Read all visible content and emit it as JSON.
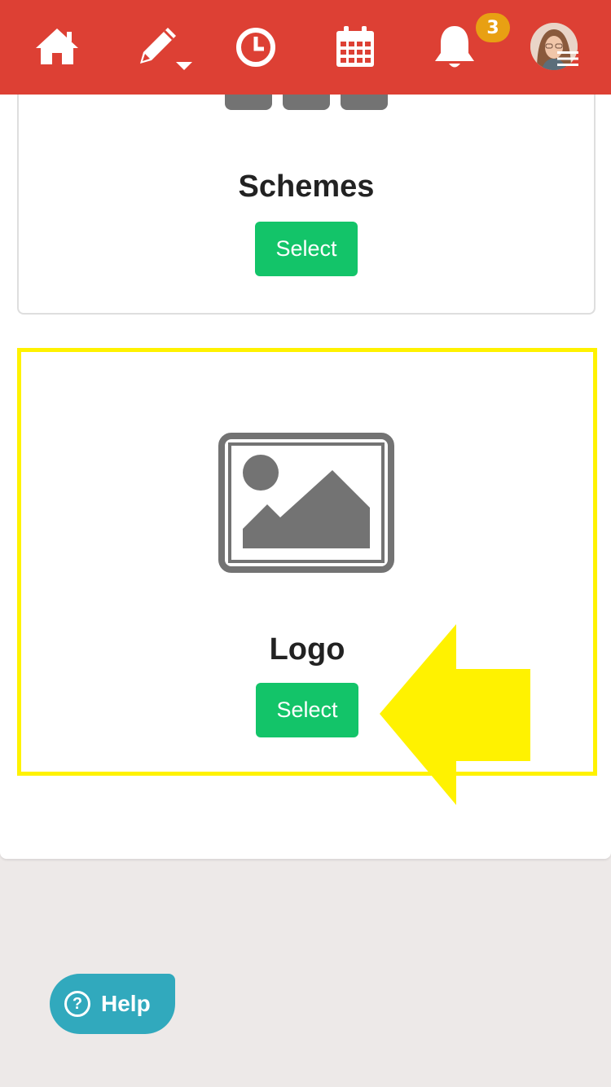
{
  "nav": {
    "icons": [
      "home-icon",
      "pencil-icon",
      "clock-icon",
      "calendar-icon",
      "bell-icon",
      "menu-icon"
    ],
    "notification_count": "3",
    "colors": {
      "bar": "#dd4034",
      "badge": "#e8a013"
    }
  },
  "cards": [
    {
      "title": "Schemes",
      "button_label": "Select"
    },
    {
      "title": "Logo",
      "button_label": "Select",
      "highlighted": true,
      "icon": "image-placeholder-icon"
    }
  ],
  "help": {
    "label": "Help",
    "icon_glyph": "?",
    "color": "#31a9bd"
  },
  "colors": {
    "select_button": "#13c469",
    "highlight": "#fff200",
    "icon_gray": "#737373"
  }
}
